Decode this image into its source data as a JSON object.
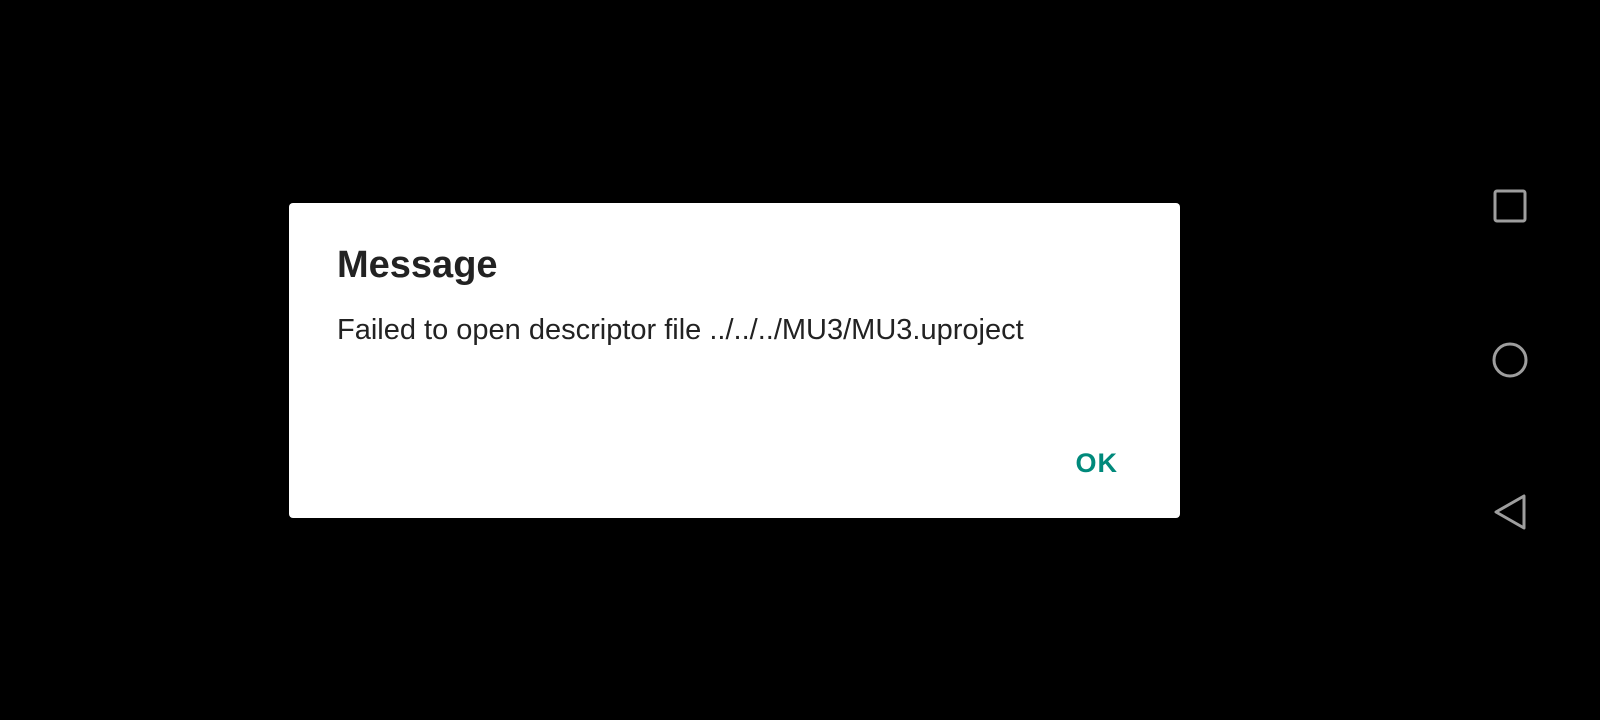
{
  "dialog": {
    "title": "Message",
    "message": "Failed to open descriptor file ../../../MU3/MU3.uproject",
    "ok_label": "OK"
  },
  "navigation_bar": {
    "buttons": [
      {
        "icon": "square-icon",
        "action": "recents"
      },
      {
        "icon": "circle-icon",
        "action": "home"
      },
      {
        "icon": "triangle-back-icon",
        "action": "back"
      }
    ]
  },
  "colors": {
    "background": "#000000",
    "dialog_background": "#ffffff",
    "accent": "#00897b",
    "nav_icon": "#9e9e9e"
  }
}
